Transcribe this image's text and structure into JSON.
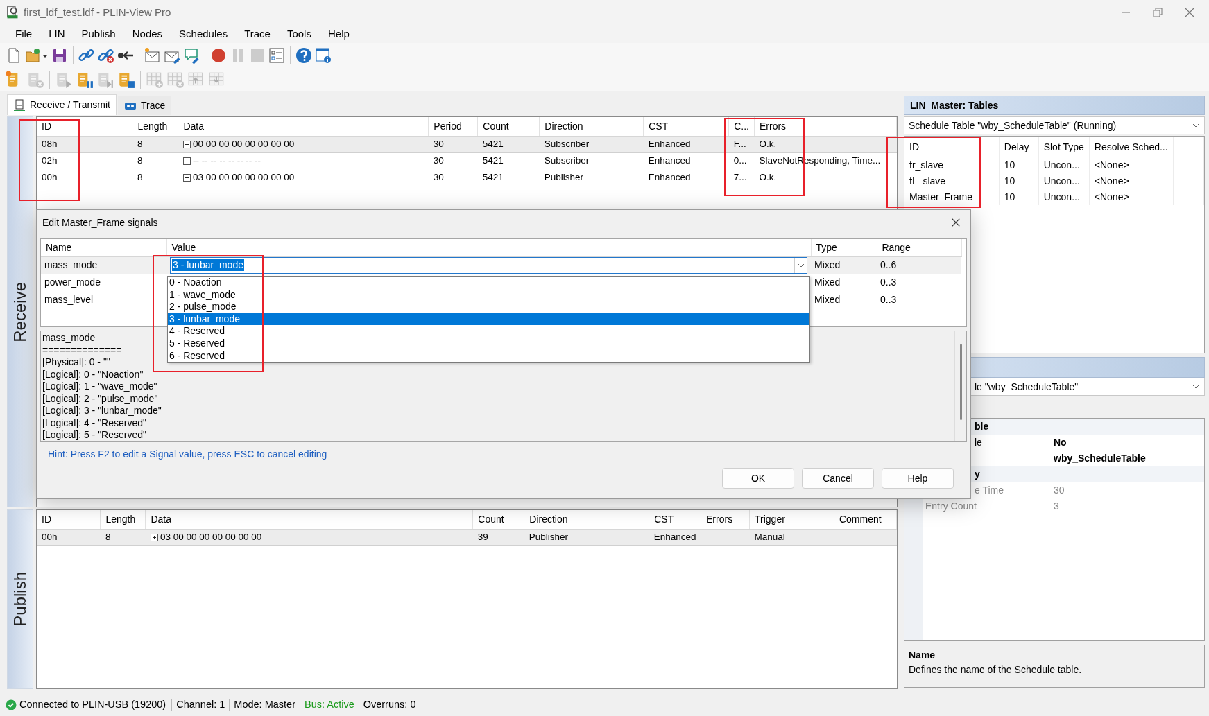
{
  "window": {
    "title": "first_ldf_test.ldf - PLIN-View Pro"
  },
  "menu": [
    "File",
    "LIN",
    "Publish",
    "Nodes",
    "Schedules",
    "Trace",
    "Tools",
    "Help"
  ],
  "toolbar_1": [
    {
      "disabled": false
    },
    {
      "disabled": false
    },
    {
      "disabled": false
    },
    {
      "disabled": false
    },
    {
      "disabled": false
    },
    {
      "disabled": false
    },
    {
      "disabled": false
    },
    {
      "disabled": false
    },
    {
      "disabled": false
    },
    {
      "disabled": false
    },
    {
      "disabled": true
    },
    {
      "disabled": true
    },
    {
      "disabled": false
    },
    {
      "disabled": false
    },
    {
      "disabled": false
    }
  ],
  "toolbar_2": [
    {
      "disabled": false
    },
    {
      "disabled": true
    },
    {
      "disabled": true
    },
    {
      "disabled": false
    },
    {
      "disabled": true
    },
    {
      "disabled": false
    },
    {
      "disabled": true
    },
    {
      "disabled": true
    },
    {
      "disabled": true
    },
    {
      "disabled": true
    }
  ],
  "tabs": [
    {
      "label": "Receive / Transmit",
      "selected": true
    },
    {
      "label": "Trace",
      "selected": false
    }
  ],
  "receive": {
    "label": "Receive",
    "columns": [
      "ID",
      "Length",
      "Data",
      "Period",
      "Count",
      "Direction",
      "CST",
      "C...",
      "Errors"
    ],
    "rows": [
      {
        "selected": true,
        "cells": [
          "08h",
          "8",
          "00 00 00 00 00 00 00 00",
          "30",
          "5421",
          "Subscriber",
          "Enhanced",
          "F...",
          "O.k."
        ]
      },
      {
        "selected": false,
        "cells": [
          "02h",
          "8",
          "-- -- -- -- -- -- -- --",
          "30",
          "5421",
          "Subscriber",
          "Enhanced",
          "0...",
          "SlaveNotResponding, Time..."
        ]
      },
      {
        "selected": false,
        "cells": [
          "00h",
          "8",
          "03 00 00 00 00 00 00 00",
          "30",
          "5421",
          "Publisher",
          "Enhanced",
          "7...",
          "O.k."
        ]
      }
    ]
  },
  "publish": {
    "label": "Publish",
    "columns": [
      "ID",
      "Length",
      "Data",
      "Count",
      "Direction",
      "CST",
      "Errors",
      "Trigger",
      "Comment"
    ],
    "rows": [
      {
        "selected": true,
        "cells": [
          "00h",
          "8",
          "03 00 00 00 00 00 00 00",
          "39",
          "Publisher",
          "Enhanced",
          null,
          "Manual",
          null
        ]
      }
    ]
  },
  "dialog": {
    "title": "Edit Master_Frame signals",
    "columns": [
      "Name",
      "Value",
      "Type",
      "Range"
    ],
    "signals": [
      {
        "name": "mass_mode",
        "value": "3 - lunbar_mode",
        "type": "Mixed",
        "range": "0..6",
        "selected": true,
        "editing": true
      },
      {
        "name": "power_mode",
        "type": "Mixed",
        "range": "0..3",
        "selected": false,
        "editing": false
      },
      {
        "name": "mass_level",
        "type": "Mixed",
        "range": "0..3",
        "selected": false,
        "editing": false
      }
    ],
    "value_options": {
      "expanded": true,
      "items": [
        {
          "label": "0 - Noaction",
          "selected": false
        },
        {
          "label": "1 - wave_mode",
          "selected": false
        },
        {
          "label": "2 - pulse_mode",
          "selected": false
        },
        {
          "label": "3 - lunbar_mode",
          "selected": true
        },
        {
          "label": "4 - Reserved",
          "selected": false
        },
        {
          "label": "5 - Reserved",
          "selected": false
        },
        {
          "label": "6 - Reserved",
          "selected": false
        }
      ]
    },
    "info_lines": [
      "mass_mode",
      "==============",
      "[Physical]: 0 - \"\"",
      "[Logical]: 0 - \"Noaction\"",
      "[Logical]: 1 - \"wave_mode\"",
      "[Logical]: 2 - \"pulse_mode\"",
      "[Logical]: 3 - \"lunbar_mode\"",
      "[Logical]: 4 - \"Reserved\"",
      "[Logical]: 5 - \"Reserved\""
    ],
    "hint": "Hint: Press F2 to edit a Signal value, press ESC to cancel editing",
    "buttons": [
      "OK",
      "Cancel",
      "Help"
    ]
  },
  "right_panel": {
    "title": "LIN_Master: Tables",
    "schedule_select": "Schedule Table \"wby_ScheduleTable\" (Running)",
    "columns": [
      "ID",
      "Delay",
      "Slot Type",
      "Resolve Sched..."
    ],
    "rows": [
      [
        "fr_slave",
        "10",
        "Uncon...",
        "<None>"
      ],
      [
        "fL_slave",
        "10",
        "Uncon...",
        "<None>"
      ],
      [
        "Master_Frame",
        "10",
        "Uncon...",
        "<None>"
      ]
    ],
    "properties_select": "le \"wby_ScheduleTable\"",
    "properties": [
      {
        "kind": "category",
        "name": "ble"
      },
      {
        "kind": "property",
        "name": "le",
        "value": "No",
        "readonly": false
      },
      {
        "kind": "property",
        "value": "wby_ScheduleTable",
        "readonly": false
      },
      {
        "kind": "category",
        "name": "y"
      },
      {
        "kind": "property",
        "name": "e Time",
        "value": "30",
        "readonly": true
      },
      {
        "kind": "property",
        "name": "Entry Count",
        "value": "3",
        "readonly": true
      }
    ],
    "description": {
      "title": "Name",
      "text": "Defines the name of the Schedule table."
    }
  },
  "annotations": [
    {
      "kind": "frame"
    },
    {
      "kind": "frame"
    },
    {
      "kind": "frame"
    },
    {
      "kind": "frame"
    }
  ],
  "status_bar": {
    "connection": "Connected to PLIN-USB (19200)",
    "fields": [
      {
        "text": "Channel: 1",
        "color": "#000000"
      },
      {
        "text": "Mode: Master",
        "color": "#000000"
      },
      {
        "text": "Bus: Active",
        "color": "#1a9a1a"
      },
      {
        "text": "Overruns: 0",
        "color": "#000000"
      }
    ]
  }
}
